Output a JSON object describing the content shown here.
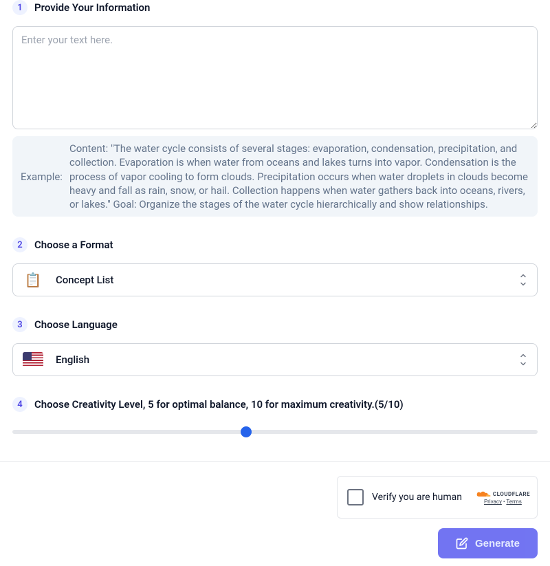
{
  "steps": {
    "s1": {
      "num": "1",
      "title": "Provide Your Information",
      "placeholder": "Enter your text here.",
      "example_label": "Example:",
      "example_text": "Content: \"The water cycle consists of several stages: evaporation, condensation, precipitation, and collection. Evaporation is when water from oceans and lakes turns into vapor. Condensation is the process of vapor cooling to form clouds. Precipitation occurs when water droplets in clouds become heavy and fall as rain, snow, or hail. Collection happens when water gathers back into oceans, rivers, or lakes.\" Goal: Organize the stages of the water cycle hierarchically and show relationships."
    },
    "s2": {
      "num": "2",
      "title": "Choose a Format",
      "selected": "Concept List"
    },
    "s3": {
      "num": "3",
      "title": "Choose Language",
      "selected": "English"
    },
    "s4": {
      "num": "4",
      "title": "Choose Creativity Level, 5 for optimal balance, 10 for maximum creativity.(5/10)",
      "value": 5,
      "max": 10
    }
  },
  "captcha": {
    "text": "Verify you are human",
    "brand": "CLOUDFLARE",
    "privacy": "Privacy",
    "terms": "Terms"
  },
  "buttons": {
    "generate": "Generate"
  }
}
